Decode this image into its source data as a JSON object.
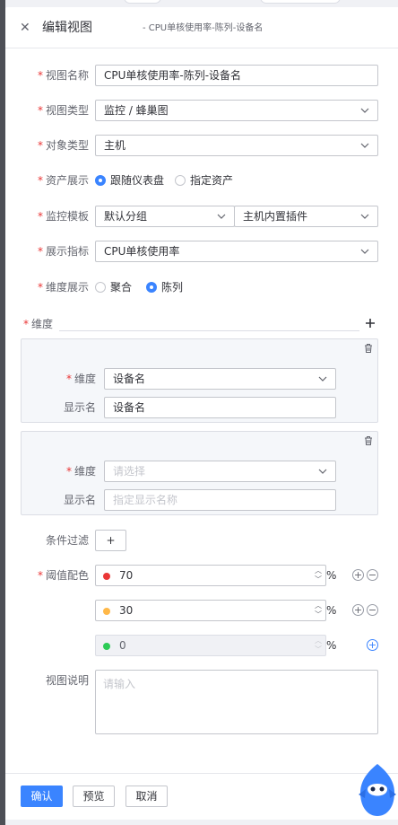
{
  "header": {
    "title": "编辑视图",
    "subtitle": "- CPU单核使用率-陈列-设备名"
  },
  "form": {
    "view_name": {
      "label": "视图名称",
      "value": "CPU单核使用率-陈列-设备名"
    },
    "view_type": {
      "label": "视图类型",
      "value": "监控 / 蜂巢图"
    },
    "object_type": {
      "label": "对象类型",
      "value": "主机"
    },
    "asset_display": {
      "label": "资产展示",
      "options": [
        "跟随仪表盘",
        "指定资产"
      ],
      "selected": "跟随仪表盘"
    },
    "monitor_template": {
      "label": "监控模板",
      "value1": "默认分组",
      "value2": "主机内置插件"
    },
    "display_metric": {
      "label": "展示指标",
      "value": "CPU单核使用率"
    },
    "dimension_display": {
      "label": "维度展示",
      "options": [
        "聚合",
        "陈列"
      ],
      "selected": "陈列"
    }
  },
  "dimensions": {
    "section_label": "维度",
    "cards": [
      {
        "dim_label": "维度",
        "dim_value": "设备名",
        "display_label": "显示名",
        "display_value": "设备名"
      },
      {
        "dim_label": "维度",
        "dim_placeholder": "请选择",
        "display_label": "显示名",
        "display_placeholder": "指定显示名称"
      }
    ]
  },
  "condition_filter": {
    "label": "条件过滤",
    "button": "+"
  },
  "threshold": {
    "label": "阈值配色",
    "unit": "%",
    "rows": [
      {
        "value": "70",
        "color": "#ea3636"
      },
      {
        "value": "30",
        "color": "#ffb848"
      },
      {
        "value": "0",
        "color": "#2dcb56"
      }
    ]
  },
  "description": {
    "label": "视图说明",
    "placeholder": "请输入"
  },
  "footer": {
    "confirm": "确认",
    "preview": "预览",
    "cancel": "取消"
  }
}
